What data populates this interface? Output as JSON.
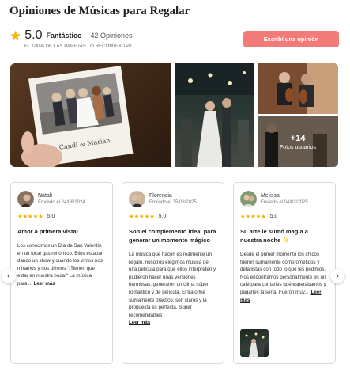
{
  "header": {
    "title": "Opiniones de Músicas para Regalar"
  },
  "summary": {
    "score": "5.0",
    "verdict": "Fantástico",
    "separator": "·",
    "count": "42 Opiniones",
    "recommend": "EL 100% DE LAS PAREJAS LO RECOMIENDAN",
    "write_button": "Escribí una opinión",
    "star_color": "#f5b400",
    "button_color": "#f27a78"
  },
  "gallery": {
    "photo1_sign": "Candi & Marian",
    "more_count": "+14",
    "more_label": "Fotos usuarios"
  },
  "reviews": [
    {
      "author": "Natali",
      "date": "Enviado el 24/06/2024",
      "stars": "★★★★★",
      "score": "5.0",
      "title": "Amor a primera vista!",
      "body": "Los conocimos un Día de San Valentín en un local gastronómico. Ellos estaban dando un show y cuando los vimos nos miramos y nos dijimos \"¡Tienen que estar en nuestra boda!\" La música para...",
      "more": "Leer más"
    },
    {
      "author": "Florencia",
      "date": "Enviado el 25/03/2025",
      "stars": "★★★★★",
      "score": "5.0",
      "title": "Son el complemento ideal para generar un momento mágico",
      "body": "La música que hacen es realmente un regalo, nosotros elegimos música de una película para que ellos interpreten y pudieron hacer unas versiones hermosas, generaron un clima súper romántico y de película. El trato fue sumamente práctico, son claros y la propuesta es perfecta. Súper recomendables",
      "more": "Leer más"
    },
    {
      "author": "Melissa",
      "date": "Enviado el 04/03/2025",
      "stars": "★★★★★",
      "score": "5.0",
      "title": "Su arte le sumó magia a nuestra noche ✨",
      "body": "Desde el primer momento los chicos fueron sumamente comprometidos y detallistas con todo lo que les pedimos. Nos encontramos personalmente en un café para contarles qué esperábamos y pagarles la seña. Fueron muy...",
      "more": "Leer más"
    }
  ],
  "carousel": {
    "prev_icon": "‹",
    "next_icon": "›"
  }
}
